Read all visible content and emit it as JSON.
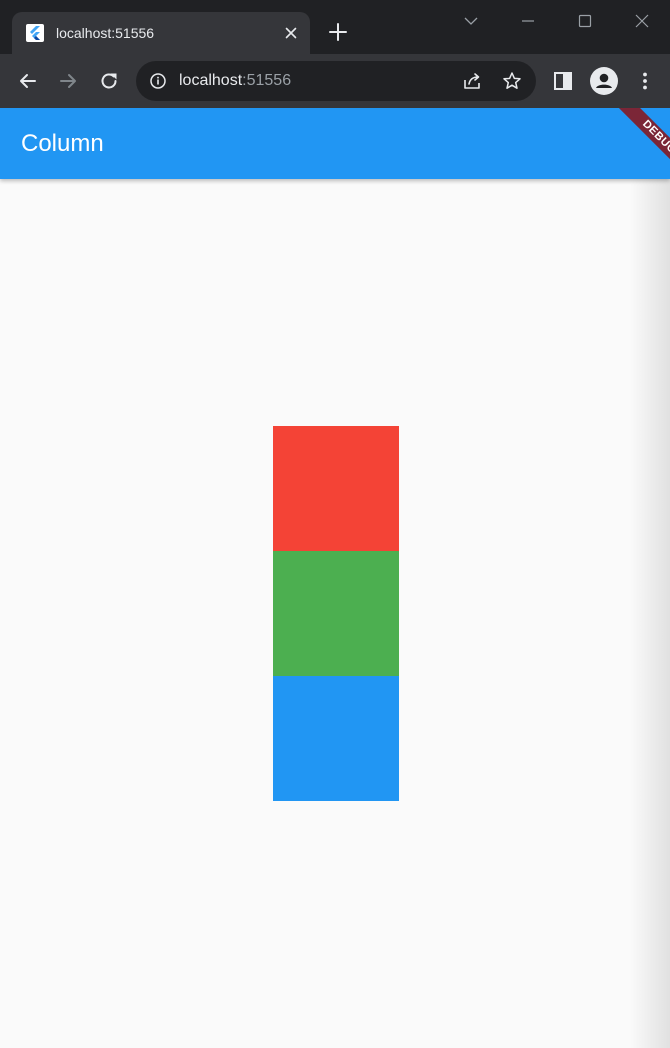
{
  "browser": {
    "tab": {
      "title": "localhost:51556",
      "favicon": "flutter-logo-icon",
      "close_icon": "close-icon"
    },
    "new_tab_icon": "plus-icon",
    "window_controls": [
      "chevron-down-icon",
      "minimize-icon",
      "maximize-icon",
      "close-icon"
    ],
    "toolbar": {
      "back_icon": "arrow-left-icon",
      "forward_icon": "arrow-right-icon",
      "reload_icon": "reload-icon",
      "site_info_icon": "info-icon",
      "url_host": "localhost",
      "url_port": ":51556",
      "share_icon": "share-icon",
      "bookmark_icon": "star-icon",
      "side_panel_icon": "side-panel-icon",
      "profile_icon": "person-icon",
      "menu_icon": "kebab-menu-icon"
    }
  },
  "app": {
    "appbar_title": "Column",
    "debug_banner": "DEBUG",
    "colors": {
      "appbar": "#2196f3",
      "background": "#fafafa",
      "debug_banner": "#7b2637"
    },
    "boxes": [
      {
        "color": "#f44336"
      },
      {
        "color": "#4caf50"
      },
      {
        "color": "#2196f3"
      }
    ]
  }
}
